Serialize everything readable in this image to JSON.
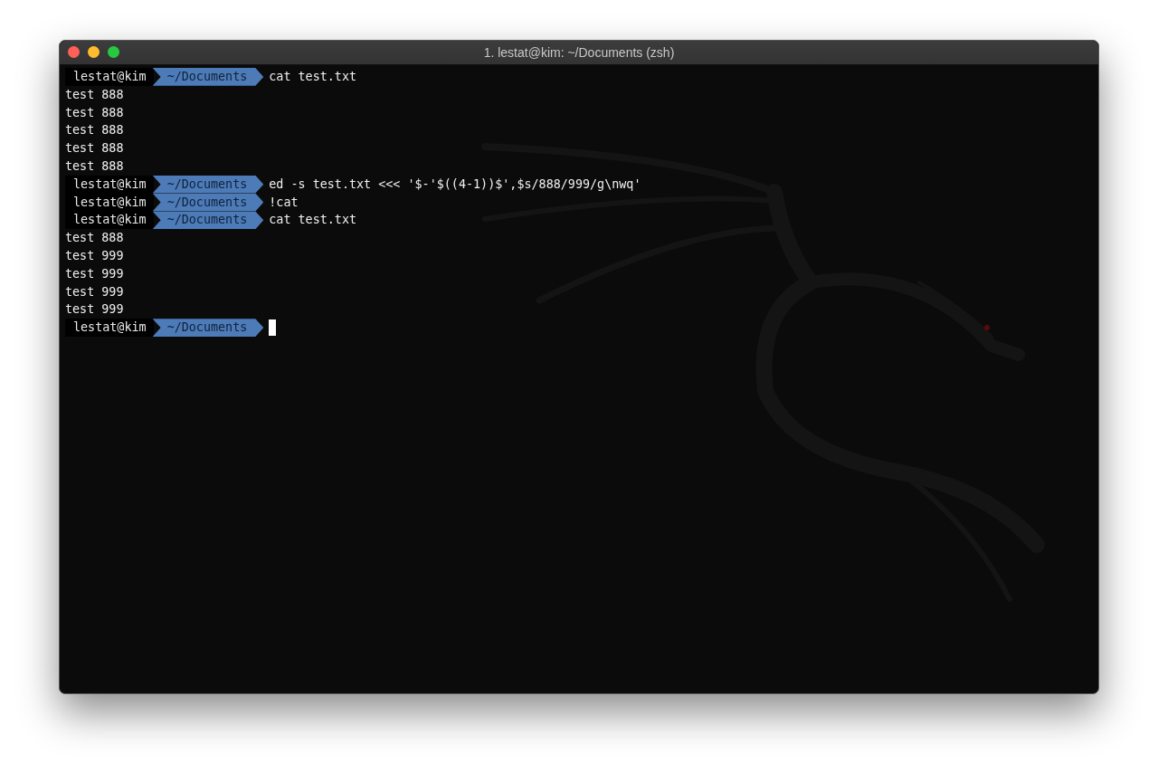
{
  "window": {
    "title": "1. lestat@kim: ~/Documents (zsh)"
  },
  "lines": [
    {
      "kind": "prompt",
      "user": "lestat@kim",
      "path": "~/Documents",
      "command": "cat test.txt",
      "cursor": false
    },
    {
      "kind": "output",
      "text": "test 888"
    },
    {
      "kind": "output",
      "text": "test 888"
    },
    {
      "kind": "output",
      "text": "test 888"
    },
    {
      "kind": "output",
      "text": "test 888"
    },
    {
      "kind": "output",
      "text": "test 888"
    },
    {
      "kind": "prompt",
      "user": "lestat@kim",
      "path": "~/Documents",
      "command": "ed -s test.txt <<< '$-'$((4-1))$',$s/888/999/g\\nwq'",
      "cursor": false
    },
    {
      "kind": "prompt",
      "user": "lestat@kim",
      "path": "~/Documents",
      "command": "!cat",
      "cursor": false
    },
    {
      "kind": "prompt",
      "user": "lestat@kim",
      "path": "~/Documents",
      "command": "cat test.txt",
      "cursor": false
    },
    {
      "kind": "output",
      "text": "test 888"
    },
    {
      "kind": "output",
      "text": "test 999"
    },
    {
      "kind": "output",
      "text": "test 999"
    },
    {
      "kind": "output",
      "text": "test 999"
    },
    {
      "kind": "output",
      "text": "test 999"
    },
    {
      "kind": "prompt",
      "user": "lestat@kim",
      "path": "~/Documents",
      "cursor": true
    }
  ]
}
